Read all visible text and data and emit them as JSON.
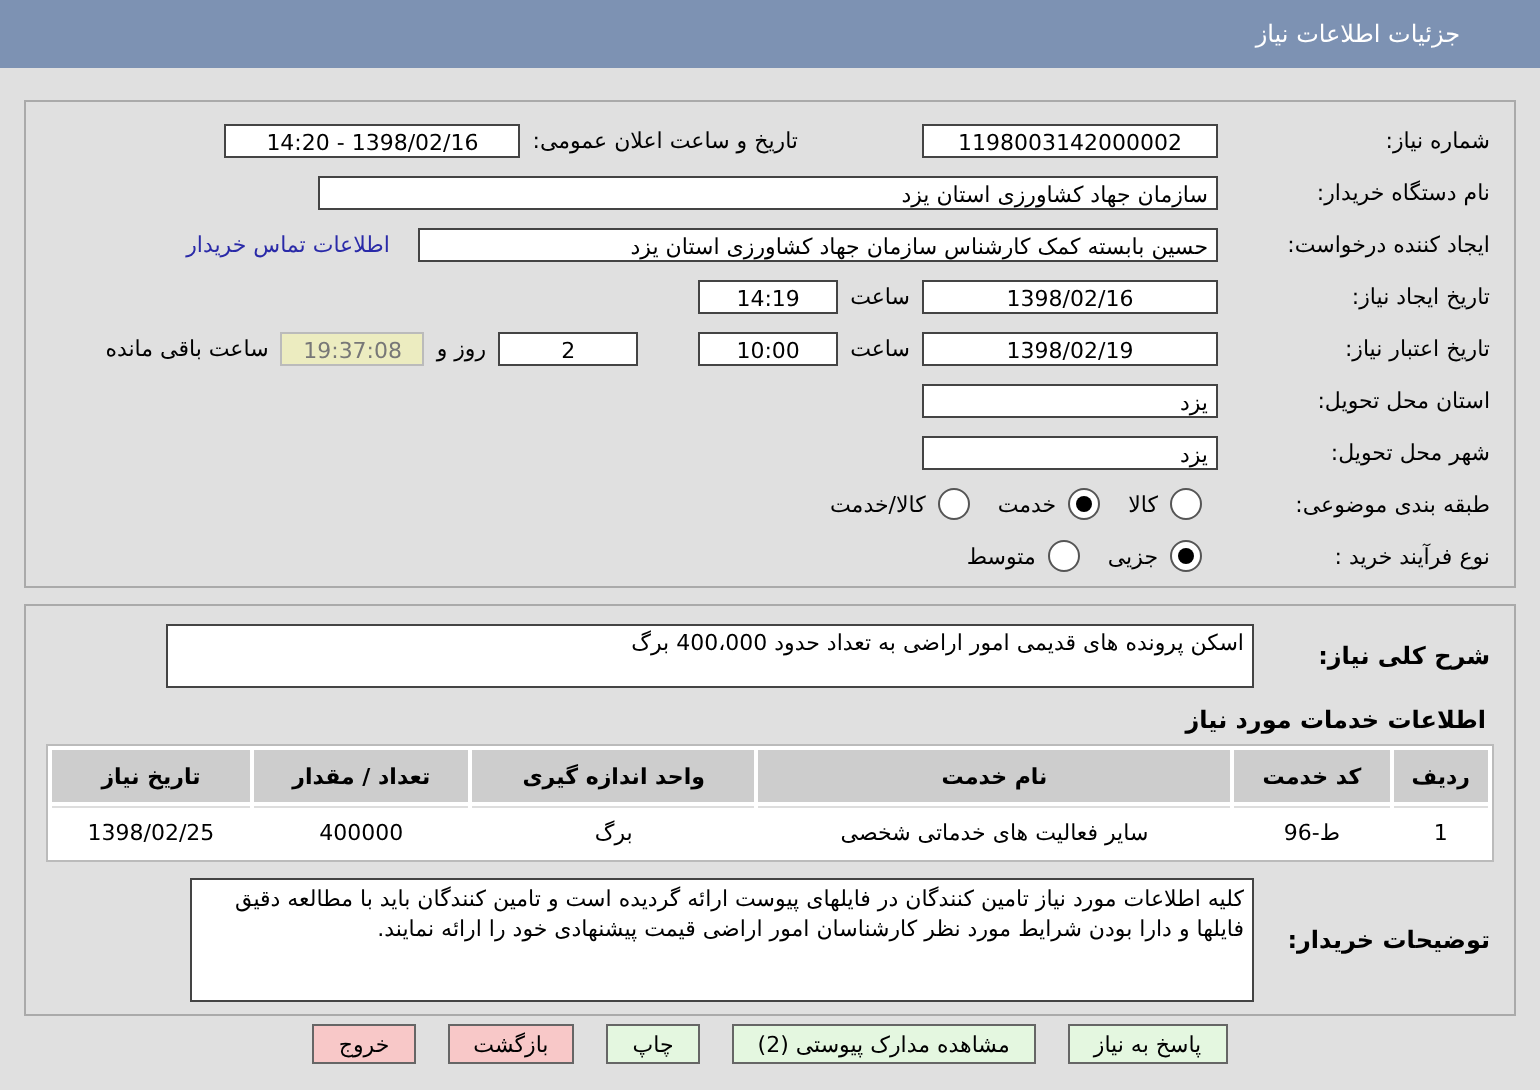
{
  "header": {
    "title": "جزئیات اطلاعات نیاز"
  },
  "info": {
    "need_number": {
      "label": "شماره نیاز:",
      "value": "1198003142000002"
    },
    "announce": {
      "label": "تاریخ و ساعت اعلان عمومی:",
      "value": "1398/02/16 - 14:20"
    },
    "buyer_org": {
      "label": "نام دستگاه خریدار:",
      "value": "سازمان جهاد کشاورزی استان یزد"
    },
    "requester": {
      "label": "ایجاد کننده درخواست:",
      "value": "حسین بابسته کمک کارشناس سازمان جهاد کشاورزی استان یزد",
      "link": "اطلاعات تماس خریدار"
    },
    "created": {
      "label": "تاریخ ایجاد نیاز:",
      "date": "1398/02/16",
      "time_label": "ساعت",
      "time": "14:19"
    },
    "validity": {
      "label": "تاریخ اعتبار نیاز:",
      "date": "1398/02/19",
      "time_label": "ساعت",
      "time": "10:00",
      "days": "2",
      "days_label": "روز و",
      "remaining": "19:37:08",
      "remaining_label": "ساعت باقی مانده"
    },
    "province": {
      "label": "استان محل تحویل:",
      "value": "یزد"
    },
    "city": {
      "label": "شهر محل تحویل:",
      "value": "یزد"
    },
    "category": {
      "label": "طبقه بندی موضوعی:",
      "options": [
        {
          "label": "کالا",
          "selected": false
        },
        {
          "label": "خدمت",
          "selected": true
        },
        {
          "label": "کالا/خدمت",
          "selected": false
        }
      ]
    },
    "process": {
      "label": "نوع فرآیند خرید :",
      "options": [
        {
          "label": "جزیی",
          "selected": true
        },
        {
          "label": "متوسط",
          "selected": false
        }
      ]
    }
  },
  "details": {
    "summary_label": "شرح کلی نیاز:",
    "summary": "اسکن پرونده های قدیمی امور اراضی به تعداد حدود 400،000 برگ",
    "services_heading": "اطلاعات خدمات مورد نیاز",
    "table": {
      "columns": [
        "ردیف",
        "کد خدمت",
        "نام خدمت",
        "واحد اندازه گیری",
        "تعداد / مقدار",
        "تاریخ نیاز"
      ],
      "rows": [
        [
          "1",
          "ط-96",
          "سایر فعالیت های خدماتی شخصی",
          "برگ",
          "400000",
          "1398/02/25"
        ]
      ]
    },
    "notes_label": "توضیحات خریدار:",
    "notes": "کلیه اطلاعات مورد نیاز تامین کنندگان در فایلهای پیوست ارائه گردیده است و تامین کنندگان باید با مطالعه دقیق فایلها و دارا بودن شرایط مورد نظر کارشناسان امور اراضی قیمت پیشنهادی خود را ارائه نمایند."
  },
  "buttons": [
    {
      "label": "پاسخ به نیاز",
      "kind": "primary"
    },
    {
      "label": "مشاهده مدارک پیوستی (2)",
      "kind": "primary"
    },
    {
      "label": "چاپ",
      "kind": "primary"
    },
    {
      "label": "بازگشت",
      "kind": "danger"
    },
    {
      "label": "خروج",
      "kind": "danger"
    }
  ]
}
